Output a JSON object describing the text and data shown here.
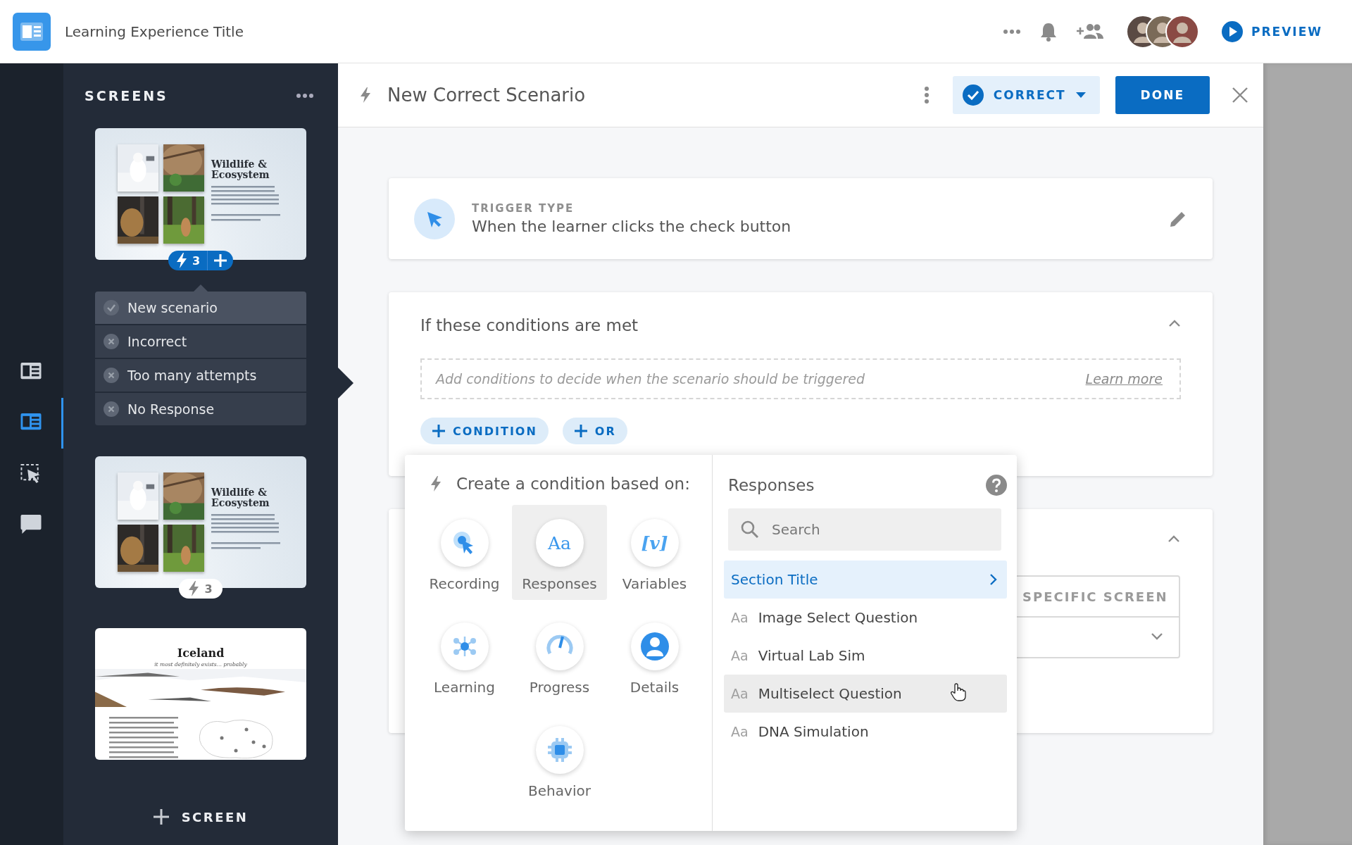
{
  "app": {
    "title": "Learning Experience Title",
    "preview": "PREVIEW"
  },
  "rail": [
    {
      "kind": "screens",
      "selected": false
    },
    {
      "kind": "layout",
      "selected": true
    },
    {
      "kind": "select",
      "selected": false
    },
    {
      "kind": "comments",
      "selected": false
    }
  ],
  "sidebar": {
    "title": "SCREENS",
    "add_label": "SCREEN",
    "screens": [
      {
        "kind": "wildlife",
        "title": "Wildlife & Ecosystem",
        "trigger_count": "3",
        "selected": true,
        "scenarios": [
          {
            "label": "New scenario",
            "kind": "check"
          },
          {
            "label": "Incorrect",
            "kind": "cross"
          },
          {
            "label": "Too many attempts",
            "kind": "cross"
          },
          {
            "label": "No Response",
            "kind": "cross"
          }
        ]
      },
      {
        "kind": "wildlife",
        "title": "Wildlife & Ecosystem",
        "trigger_count": "3",
        "selected": false
      },
      {
        "kind": "iceland",
        "title": "Iceland",
        "subtitle": "it most definitely exists... probably"
      }
    ]
  },
  "editor": {
    "title": "New Correct Scenario",
    "status": "CORRECT",
    "done": "DONE",
    "trigger": {
      "label": "TRIGGER TYPE",
      "value": "When the learner clicks the check button"
    },
    "conditions": {
      "title": "If these conditions are met",
      "expanded": true,
      "placeholder": "Add conditions to decide when the scenario should be triggered",
      "link": "Learn more",
      "buttons": [
        "CONDITION",
        "OR"
      ]
    },
    "actions": {
      "expanded": true,
      "target": "SPECIFIC SCREEN"
    }
  },
  "popup": {
    "title": "Create a condition based on:",
    "categories": [
      {
        "label": "Recording",
        "kind": "recording",
        "selected": false
      },
      {
        "label": "Responses",
        "kind": "responses",
        "glyph": "Aa",
        "selected": true
      },
      {
        "label": "Variables",
        "kind": "variables",
        "glyph": "[v]",
        "selected": false
      },
      {
        "label": "Learning",
        "kind": "learning",
        "selected": false
      },
      {
        "label": "Progress",
        "kind": "progress",
        "selected": false
      },
      {
        "label": "Details",
        "kind": "details",
        "selected": false
      },
      {
        "label": "Behavior",
        "kind": "behavior",
        "selected": false
      }
    ],
    "panel": {
      "title": "Responses",
      "search_placeholder": "Search",
      "items": [
        {
          "label": "Section Title",
          "kind": "section",
          "selected": true,
          "hovered": false
        },
        {
          "label": "Image Select Question",
          "kind": "response",
          "prefix": "Aa",
          "selected": false,
          "hovered": false
        },
        {
          "label": "Virtual Lab Sim",
          "kind": "response",
          "prefix": "Aa",
          "selected": false,
          "hovered": false
        },
        {
          "label": "Multiselect Question",
          "kind": "response",
          "prefix": "Aa",
          "selected": false,
          "hovered": true
        },
        {
          "label": "DNA Simulation",
          "kind": "response",
          "prefix": "Aa",
          "selected": false,
          "hovered": false
        }
      ]
    }
  }
}
